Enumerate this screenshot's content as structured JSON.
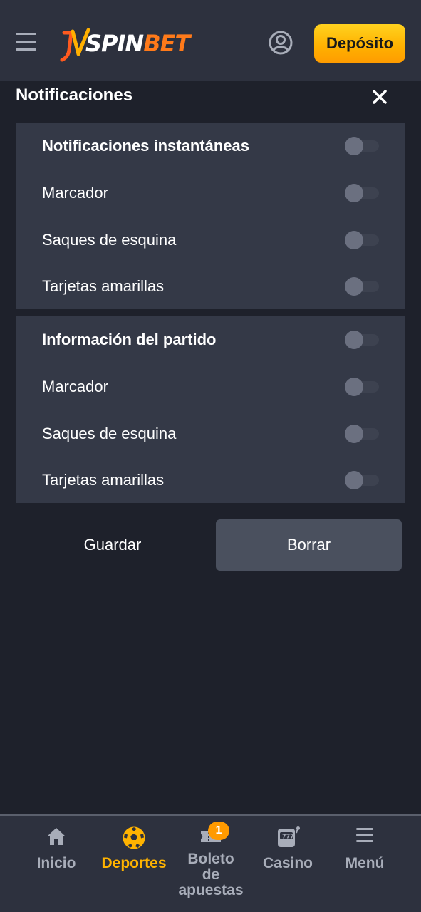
{
  "header": {
    "logo_main": "SPIN",
    "logo_accent": "BET",
    "deposit_label": "Depósito"
  },
  "panel": {
    "title": "Notificaciones"
  },
  "sections": [
    {
      "rows": [
        {
          "label": "Notificaciones instantáneas",
          "enabled": false
        },
        {
          "label": "Marcador",
          "enabled": false
        },
        {
          "label": "Saques de esquina",
          "enabled": false
        },
        {
          "label": "Tarjetas amarillas",
          "enabled": false
        }
      ]
    },
    {
      "rows": [
        {
          "label": "Información del partido",
          "enabled": false
        },
        {
          "label": "Marcador",
          "enabled": false
        },
        {
          "label": "Saques de esquina",
          "enabled": false
        },
        {
          "label": "Tarjetas amarillas",
          "enabled": false
        }
      ]
    }
  ],
  "actions": {
    "save_label": "Guardar",
    "clear_label": "Borrar"
  },
  "nav": {
    "items": [
      {
        "label": "Inicio",
        "icon": "home-icon"
      },
      {
        "label": "Deportes",
        "icon": "soccer-ball-icon",
        "active": true
      },
      {
        "label": "Boleto de apuestas",
        "label_lines": [
          "Boleto",
          "de",
          "apuestas"
        ],
        "icon": "ticket-icon",
        "badge": "1"
      },
      {
        "label": "Casino",
        "icon": "slot-machine-icon"
      },
      {
        "label": "Menú",
        "icon": "menu-icon"
      }
    ]
  },
  "colors": {
    "accent": "#ffb300",
    "deposit": "#ffb000",
    "badge": "#ff9a00"
  }
}
